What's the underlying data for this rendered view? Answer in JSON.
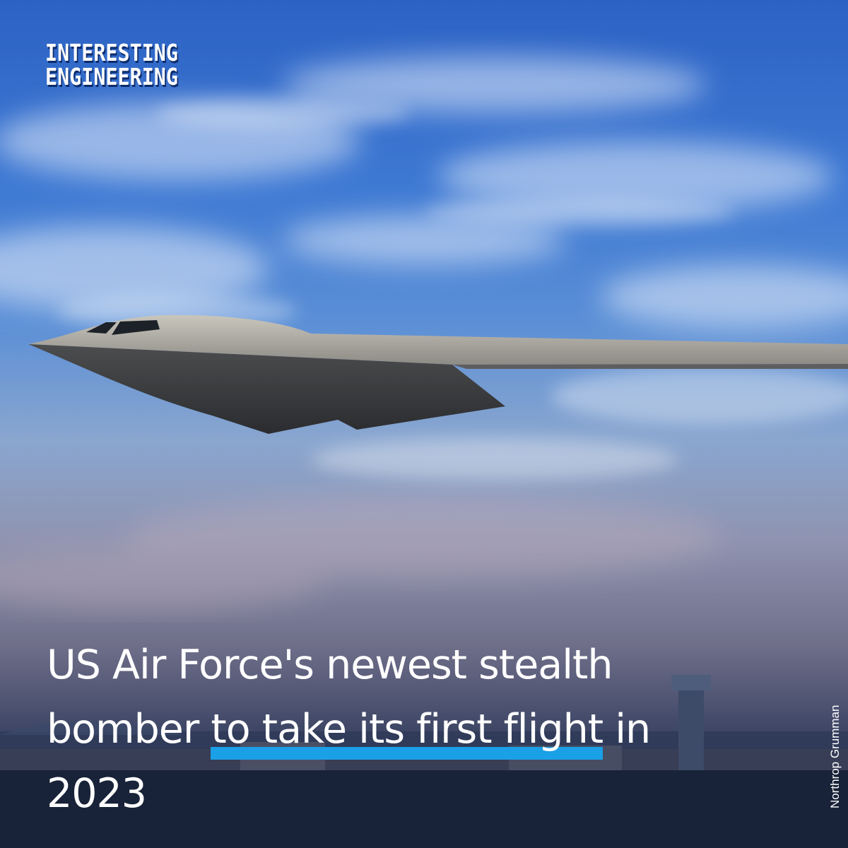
{
  "brand": {
    "line1": "INTERESTING",
    "line2": "ENGINEERING"
  },
  "headline": {
    "part1": "US Air Force's newest stealth",
    "part2a": "bomber ",
    "part2_highlight": "to take its first flight",
    "part2b": " in",
    "part3": "2023"
  },
  "credit": "Northrop Grumman",
  "colors": {
    "highlight": "#1aa0e6",
    "text": "#ffffff",
    "sky_top": "#2c62c4"
  }
}
